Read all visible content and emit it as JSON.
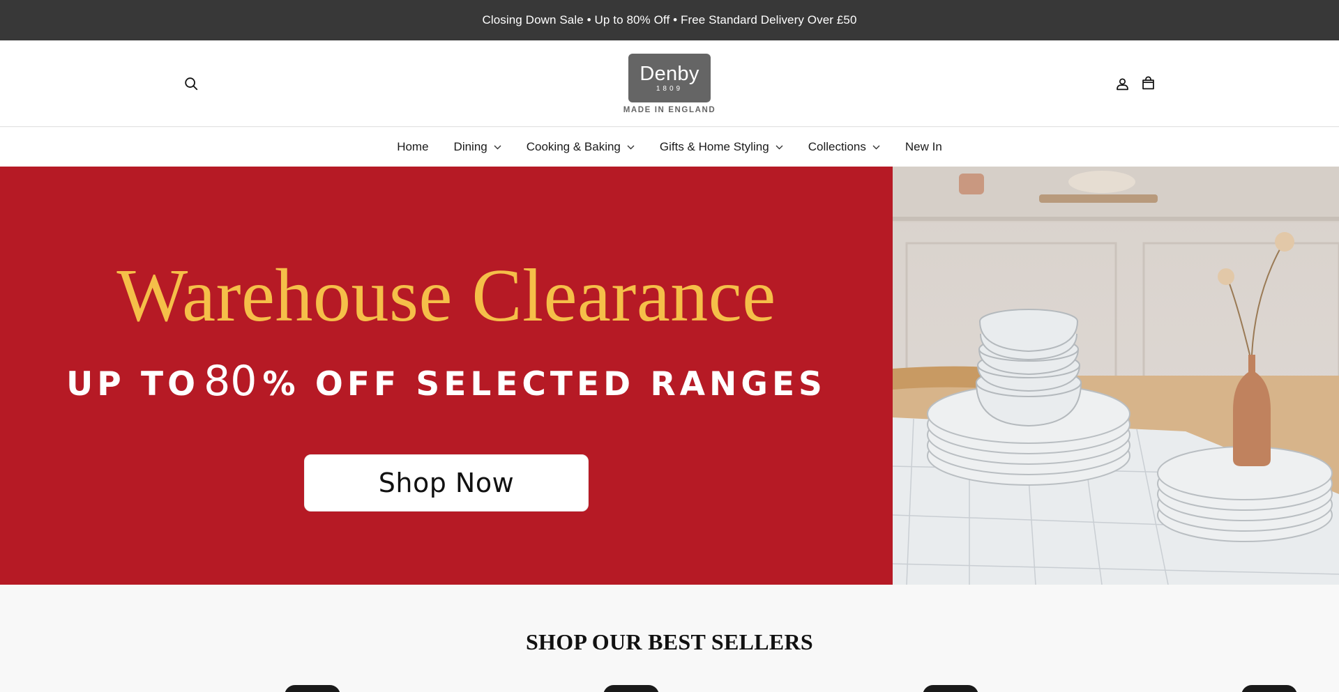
{
  "announcement": {
    "text": "Closing Down Sale • Up to 80% Off • Free Standard Delivery Over £50"
  },
  "header": {
    "logo": {
      "wordmark": "Denby",
      "year": "1809",
      "tagline": "MADE IN ENGLAND"
    },
    "icons": {
      "search": "search-icon",
      "account": "user-icon",
      "cart": "bag-icon"
    }
  },
  "nav": {
    "items": [
      {
        "label": "Home",
        "has_dropdown": false
      },
      {
        "label": "Dining",
        "has_dropdown": true
      },
      {
        "label": "Cooking & Baking",
        "has_dropdown": true
      },
      {
        "label": "Gifts & Home Styling",
        "has_dropdown": true
      },
      {
        "label": "Collections",
        "has_dropdown": true
      },
      {
        "label": "New In",
        "has_dropdown": false
      }
    ]
  },
  "hero": {
    "title": "Warehouse Clearance",
    "subtitle_pre": "UP TO",
    "subtitle_number": "80",
    "subtitle_post": "% OFF SELECTED RANGES",
    "cta_label": "Shop Now",
    "colors": {
      "background": "#b61a25",
      "title": "#f5bf49"
    }
  },
  "bestsellers": {
    "title": "SHOP OUR BEST SELLERS"
  }
}
